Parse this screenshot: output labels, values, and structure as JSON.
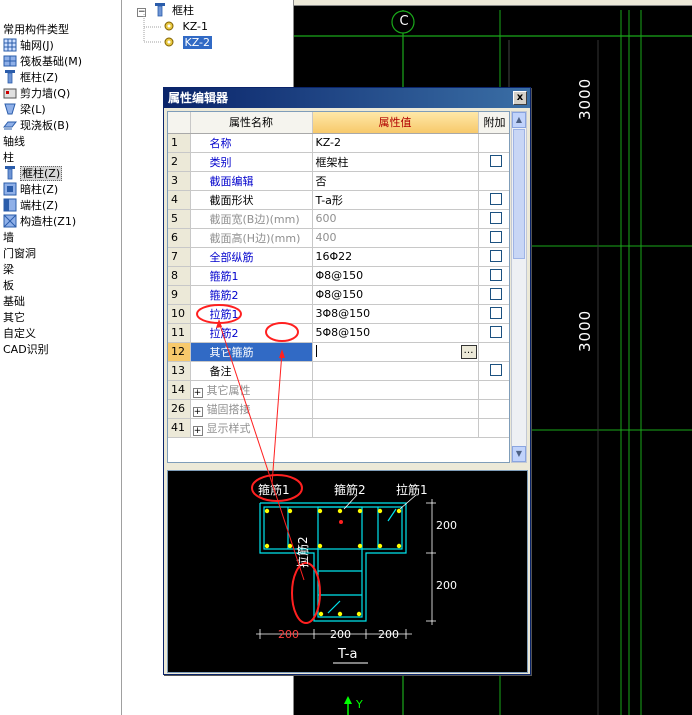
{
  "tree": {
    "categories": [
      {
        "label": "常用构件类型",
        "icon": "none"
      },
      {
        "label": "轴网(J)",
        "icon": "grid-icon"
      },
      {
        "label": "筏板基础(M)",
        "icon": "raft-foundation-icon"
      },
      {
        "label": "框柱(Z)",
        "icon": "frame-column-icon"
      },
      {
        "label": "剪力墙(Q)",
        "icon": "shear-wall-icon"
      },
      {
        "label": "梁(L)",
        "icon": "beam-icon"
      },
      {
        "label": "现浇板(B)",
        "icon": "slab-icon"
      },
      {
        "label": "轴线",
        "icon": "none"
      },
      {
        "label": "柱",
        "icon": "none"
      },
      {
        "label": "框柱(Z)",
        "icon": "frame-column-icon"
      },
      {
        "label": "暗柱(Z)",
        "icon": "hidden-column-icon"
      },
      {
        "label": "端柱(Z)",
        "icon": "end-column-icon"
      },
      {
        "label": "构造柱(Z1)",
        "icon": "structural-column-icon"
      },
      {
        "label": "墙",
        "icon": "none"
      },
      {
        "label": "门窗洞",
        "icon": "none"
      },
      {
        "label": "梁",
        "icon": "none"
      },
      {
        "label": "板",
        "icon": "none"
      },
      {
        "label": "基础",
        "icon": "none"
      },
      {
        "label": "其它",
        "icon": "none"
      },
      {
        "label": "自定义",
        "icon": "none"
      },
      {
        "label": "CAD识别",
        "icon": "none"
      }
    ]
  },
  "elements": {
    "root_label": "框柱",
    "items": [
      "KZ-1",
      "KZ-2"
    ],
    "selected": "KZ-2"
  },
  "canvas": {
    "axis_label": "C",
    "dim_top": "3000",
    "dim_bottom": "3000",
    "ucs_label": "Y"
  },
  "dialog": {
    "title": "属性编辑器",
    "close_label": "x",
    "headers": {
      "name": "属性名称",
      "value": "属性值",
      "extra": "附加"
    },
    "rows": [
      {
        "num": "1",
        "name": "名称",
        "value": "KZ-2",
        "style": "blue",
        "check": false
      },
      {
        "num": "2",
        "name": "类别",
        "value": "框架柱",
        "style": "blue",
        "check": true
      },
      {
        "num": "3",
        "name": "截面编辑",
        "value": "否",
        "style": "blue",
        "check": false
      },
      {
        "num": "4",
        "name": "截面形状",
        "value": "T-a形",
        "style": "black",
        "check": true
      },
      {
        "num": "5",
        "name": "截面宽(B边)(mm)",
        "value": "600",
        "style": "gray",
        "check": true
      },
      {
        "num": "6",
        "name": "截面高(H边)(mm)",
        "value": "400",
        "style": "gray",
        "check": true
      },
      {
        "num": "7",
        "name": "全部纵筋",
        "value": "16Φ22",
        "style": "blue",
        "check": true
      },
      {
        "num": "8",
        "name": "箍筋1",
        "value": "Φ8@150",
        "style": "blue",
        "check": true
      },
      {
        "num": "9",
        "name": "箍筋2",
        "value": "Φ8@150",
        "style": "blue",
        "check": true
      },
      {
        "num": "10",
        "name": "拉筋1",
        "value": "3Φ8@150",
        "style": "blue",
        "check": true
      },
      {
        "num": "11",
        "name": "拉筋2",
        "value": "5Φ8@150",
        "style": "blue",
        "check": true
      },
      {
        "num": "12",
        "name": "其它箍筋",
        "value": "",
        "style": "active",
        "check": false
      },
      {
        "num": "13",
        "name": "备注",
        "value": "",
        "style": "black",
        "check": true
      },
      {
        "num": "14",
        "name": "其它属性",
        "value": "",
        "style": "group",
        "check": false
      },
      {
        "num": "26",
        "name": "锚固搭接",
        "value": "",
        "style": "group",
        "check": false
      },
      {
        "num": "41",
        "name": "显示样式",
        "value": "",
        "style": "group",
        "check": false
      }
    ],
    "ellipsis_label": "…"
  },
  "preview": {
    "label_stirrup1": "箍筋1",
    "label_stirrup2": "箍筋2",
    "label_tie1": "拉筋1",
    "label_tie2": "拉筋2",
    "dim_200": "200",
    "dim_bottom_red": "200",
    "shape_name": "T-a",
    "colors": {
      "outline": "#00e5ee",
      "rebar": "#ffff00",
      "red": "#ff2020",
      "white": "#ffffff"
    }
  }
}
